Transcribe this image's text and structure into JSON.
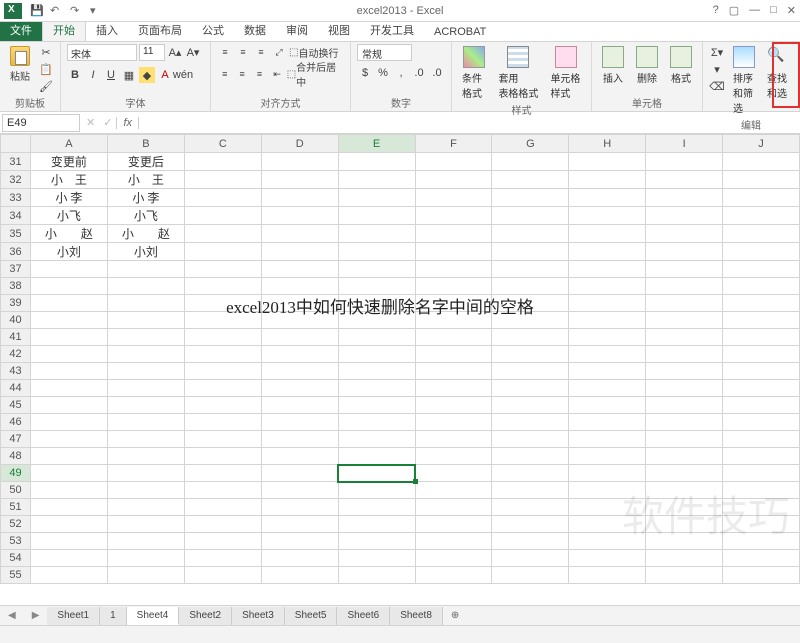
{
  "title": "excel2013 - Excel",
  "tabs": {
    "file": "文件",
    "home": "开始",
    "insert": "插入",
    "layout": "页面布局",
    "formula": "公式",
    "data": "数据",
    "review": "审阅",
    "view": "视图",
    "dev": "开发工具",
    "acrobat": "ACROBAT"
  },
  "ribbon": {
    "clipboard": {
      "label": "剪贴板",
      "paste": "粘贴"
    },
    "font": {
      "label": "字体",
      "name": "宋体",
      "size": "11"
    },
    "align": {
      "label": "对齐方式",
      "wrap": "自动换行",
      "merge": "合并后居中"
    },
    "number": {
      "label": "数字",
      "format": "常规"
    },
    "styles": {
      "label": "样式",
      "cond": "条件格式",
      "table": "套用\n表格格式",
      "cell": "单元格样式"
    },
    "cells": {
      "label": "单元格",
      "insert": "插入",
      "delete": "删除",
      "format": "格式"
    },
    "editing": {
      "label": "编辑",
      "sort": "排序和筛选",
      "find": "查找和选"
    }
  },
  "nameBox": "E49",
  "columns": [
    "A",
    "B",
    "C",
    "D",
    "E",
    "F",
    "G",
    "H",
    "I",
    "J"
  ],
  "rowStart": 31,
  "rowEnd": 55,
  "selected": {
    "row": 49,
    "col": "E"
  },
  "cells": {
    "31": {
      "A": "变更前",
      "B": "变更后"
    },
    "32": {
      "A": "小　王",
      "B": "小　王"
    },
    "33": {
      "A": "小 李",
      "B": "小 李"
    },
    "34": {
      "A": "小飞",
      "B": "小飞"
    },
    "35": {
      "A": "小　　赵",
      "B": "小　　赵"
    },
    "36": {
      "A": "小刘",
      "B": "小刘"
    }
  },
  "overlay": "excel2013中如何快速删除名字中间的空格",
  "watermark": "软件技巧",
  "sheets": [
    "Sheet1",
    "1",
    "Sheet4",
    "Sheet2",
    "Sheet3",
    "Sheet5",
    "Sheet6",
    "Sheet8"
  ],
  "activeSheet": "Sheet4"
}
